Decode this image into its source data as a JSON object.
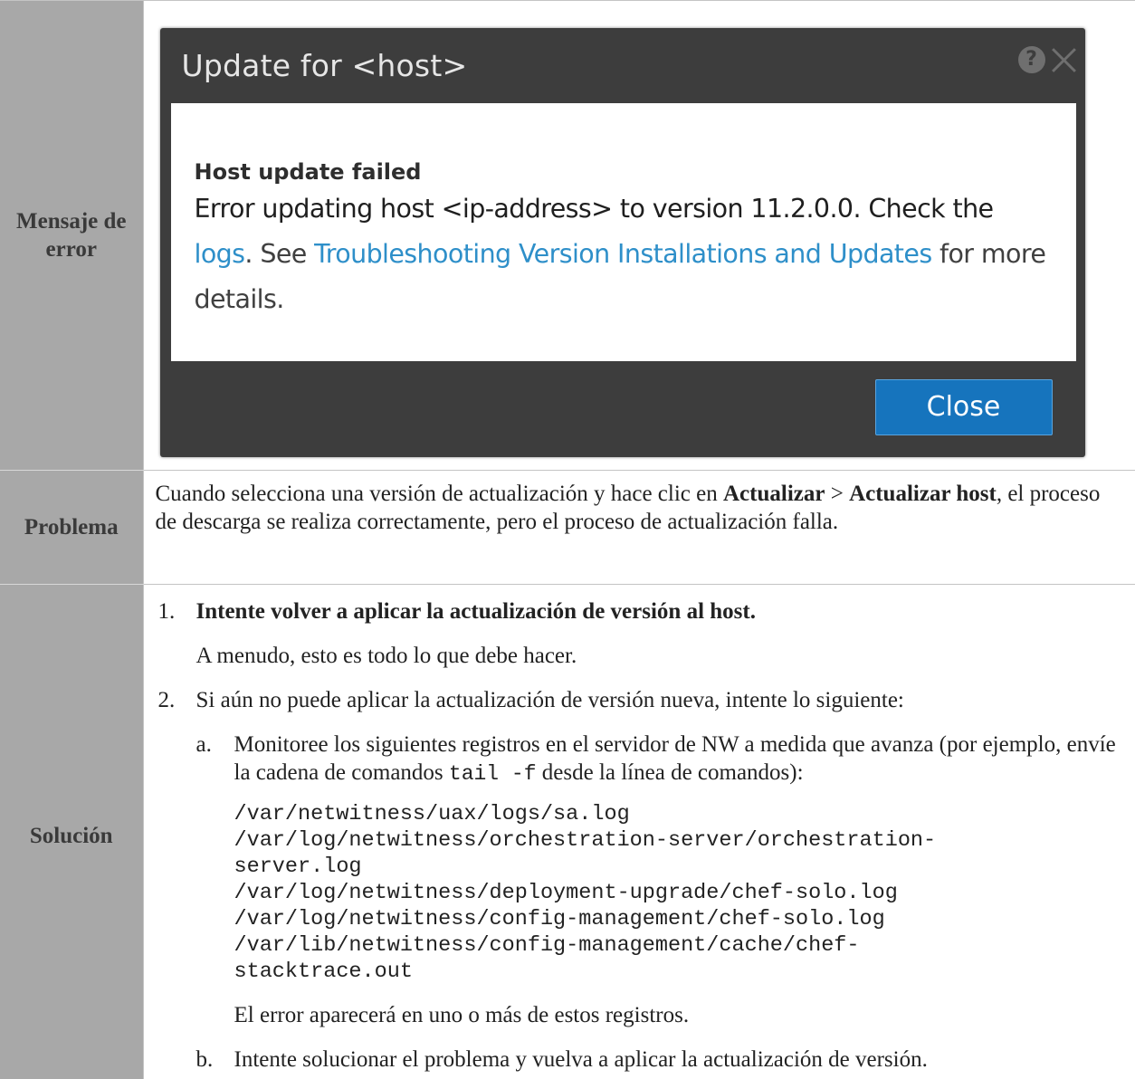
{
  "rows": {
    "error": {
      "label": "Mensaje de error"
    },
    "problem": {
      "label": "Problema",
      "text_1": "Cuando selecciona una versión de actualización y hace clic en ",
      "bold_1": "Actualizar",
      "text_2": " > ",
      "bold_2": "Actualizar host",
      "text_3": ", el proceso de descarga se realiza correctamente, pero el proceso de actualización falla."
    },
    "solution": {
      "label": "Solución",
      "step1_number": "1.",
      "step1_title": "Intente volver a aplicar la actualización de versión al host.",
      "step1_note": "A menudo, esto es todo lo que debe hacer.",
      "step2_number": "2.",
      "step2_text": "Si aún no puede aplicar la actualización de versión nueva, intente lo siguiente:",
      "sub_a_letter": "a.",
      "sub_a_text_1": "Monitoree los siguientes registros en el servidor de NW a medida que avanza (por ejemplo, envíe la cadena de comandos ",
      "sub_a_code": "tail -f",
      "sub_a_text_2": " desde la línea de comandos):",
      "log_paths": [
        "/var/netwitness/uax/logs/sa.log",
        "/var/log/netwitness/orchestration-server/orchestration-",
        "server.log",
        "/var/log/netwitness/deployment-upgrade/chef-solo.log",
        "/var/log/netwitness/config-management/chef-solo.log",
        "/var/lib/netwitness/config-management/cache/chef-",
        "stacktrace.out"
      ],
      "sub_a_after": "El error aparecerá en uno o más de estos registros.",
      "sub_b_letter": "b.",
      "sub_b_text": "Intente solucionar el problema y vuelva a aplicar la actualización de versión."
    }
  },
  "dialog": {
    "title": "Update for <host>",
    "help_icon": "?",
    "heading": "Host update failed",
    "text_1": "Error updating host <ip-address> to version 11.2.0.0. Check the ",
    "link_logs": "logs",
    "text_2": ". See ",
    "link_troubleshooting": "Troubleshooting Version Installations and Updates",
    "text_3": " for more details.",
    "close_label": "Close",
    "colors": {
      "title_bar": "#3d3d3d",
      "link": "#2e8fc9",
      "button": "#1674bd"
    }
  }
}
